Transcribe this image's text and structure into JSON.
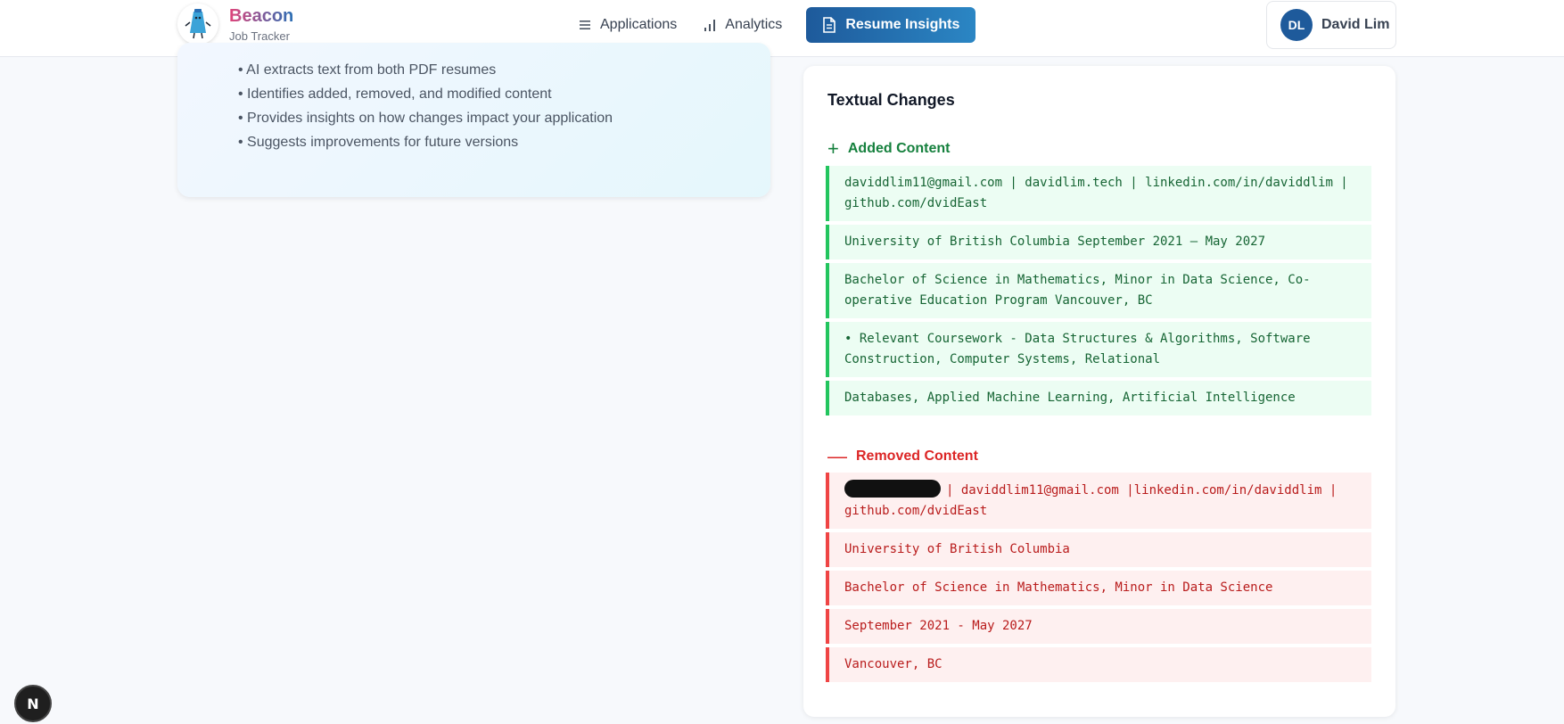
{
  "brand": {
    "name": "Beacon",
    "subtitle": "Job Tracker"
  },
  "nav": {
    "applications": "Applications",
    "analytics": "Analytics",
    "resume_insights": "Resume Insights"
  },
  "user": {
    "initials": "DL",
    "name": "David Lim"
  },
  "info": {
    "items": [
      "• AI extracts text from both PDF resumes",
      "• Identifies added, removed, and modified content",
      "• Provides insights on how changes impact your application",
      "• Suggests improvements for future versions"
    ]
  },
  "changes": {
    "title": "Textual Changes",
    "added_title": "Added Content",
    "added_symbol": "+",
    "removed_title": "Removed Content",
    "removed_symbol": "—",
    "added": [
      "daviddlim11@gmail.com | davidlim.tech | linkedin.com/in/daviddlim | github.com/dvidEast",
      "University of British Columbia September 2021 – May 2027",
      "Bachelor of Science in Mathematics, Minor in Data Science, Co-operative Education Program Vancouver, BC",
      "• Relevant Coursework - Data Structures & Algorithms, Software Construction, Computer Systems, Relational",
      "Databases, Applied Machine Learning, Artificial Intelligence"
    ],
    "removed": [
      "| daviddlim11@gmail.com |linkedin.com/in/daviddlim | github.com/dvidEast",
      "University of British Columbia",
      "Bachelor of Science in Mathematics, Minor in Data Science",
      "September 2021 - May 2027",
      "Vancouver, BC"
    ]
  },
  "dev_badge": "N",
  "colors": {
    "primary": "#1e5a9b",
    "added": "#22c55e",
    "removed": "#ef4444"
  }
}
